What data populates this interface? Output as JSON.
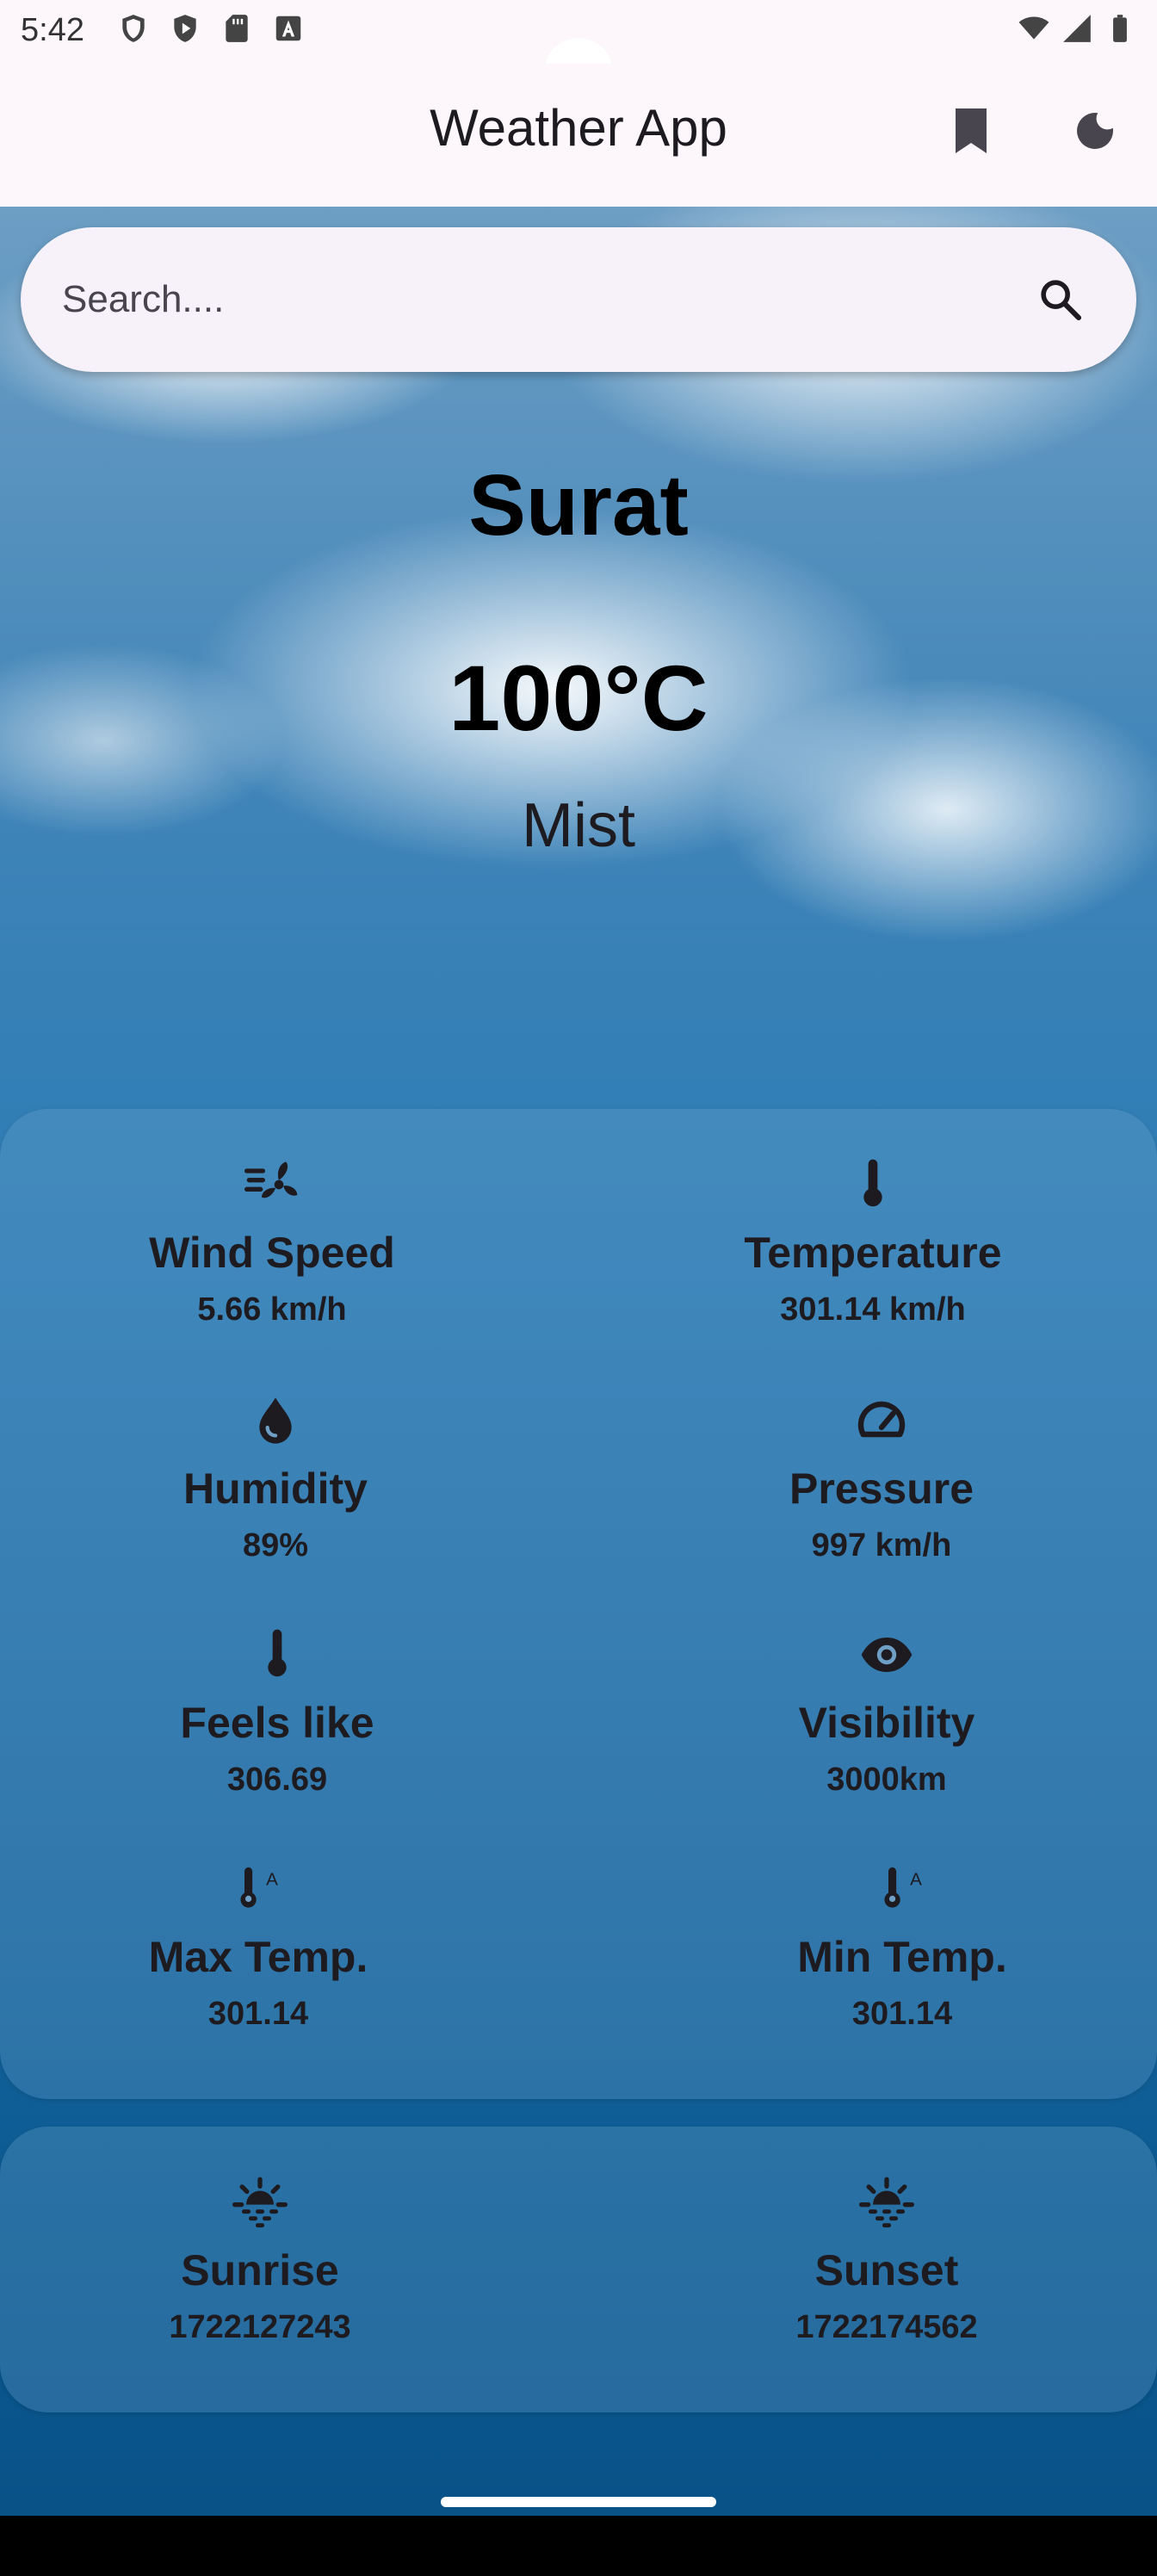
{
  "status_bar": {
    "time": "5:42",
    "icons_left": [
      "shield-icon",
      "play-protect-icon",
      "sd-card-icon",
      "keyboard-a-icon"
    ],
    "icons_right": [
      "wifi-icon",
      "signal-icon",
      "battery-icon"
    ]
  },
  "app_bar": {
    "title": "Weather App",
    "actions": [
      "bookmark-icon",
      "dark-mode-icon"
    ]
  },
  "search": {
    "placeholder": "Search...."
  },
  "weather": {
    "city": "Surat",
    "temperature": "100°C",
    "condition": "Mist"
  },
  "details": [
    {
      "icon": "wind-icon",
      "label": "Wind Speed",
      "value": "5.66 km/h"
    },
    {
      "icon": "thermometer-icon",
      "label": "Temperature",
      "value": "301.14 km/h"
    },
    {
      "icon": "humidity-drop-icon",
      "label": "Humidity",
      "value": "89%"
    },
    {
      "icon": "gauge-icon",
      "label": "Pressure",
      "value": "997 km/h"
    },
    {
      "icon": "thermometer-icon",
      "label": "Feels like",
      "value": "306.69"
    },
    {
      "icon": "eye-icon",
      "label": "Visibility",
      "value": "3000km"
    },
    {
      "icon": "thermostat-auto-icon",
      "label": "Max Temp.",
      "value": "301.14"
    },
    {
      "icon": "thermostat-auto-icon",
      "label": "Min Temp.",
      "value": "301.14"
    }
  ],
  "sun": [
    {
      "icon": "sunrise-icon",
      "label": "Sunrise",
      "value": "1722127243"
    },
    {
      "icon": "sunset-icon",
      "label": "Sunset",
      "value": "1722174562"
    }
  ],
  "colors": {
    "surface": "#fdf7fb",
    "search_bg": "#f7f2fa",
    "sky_top": "#6d9ec4",
    "sky_bottom": "#085086"
  }
}
